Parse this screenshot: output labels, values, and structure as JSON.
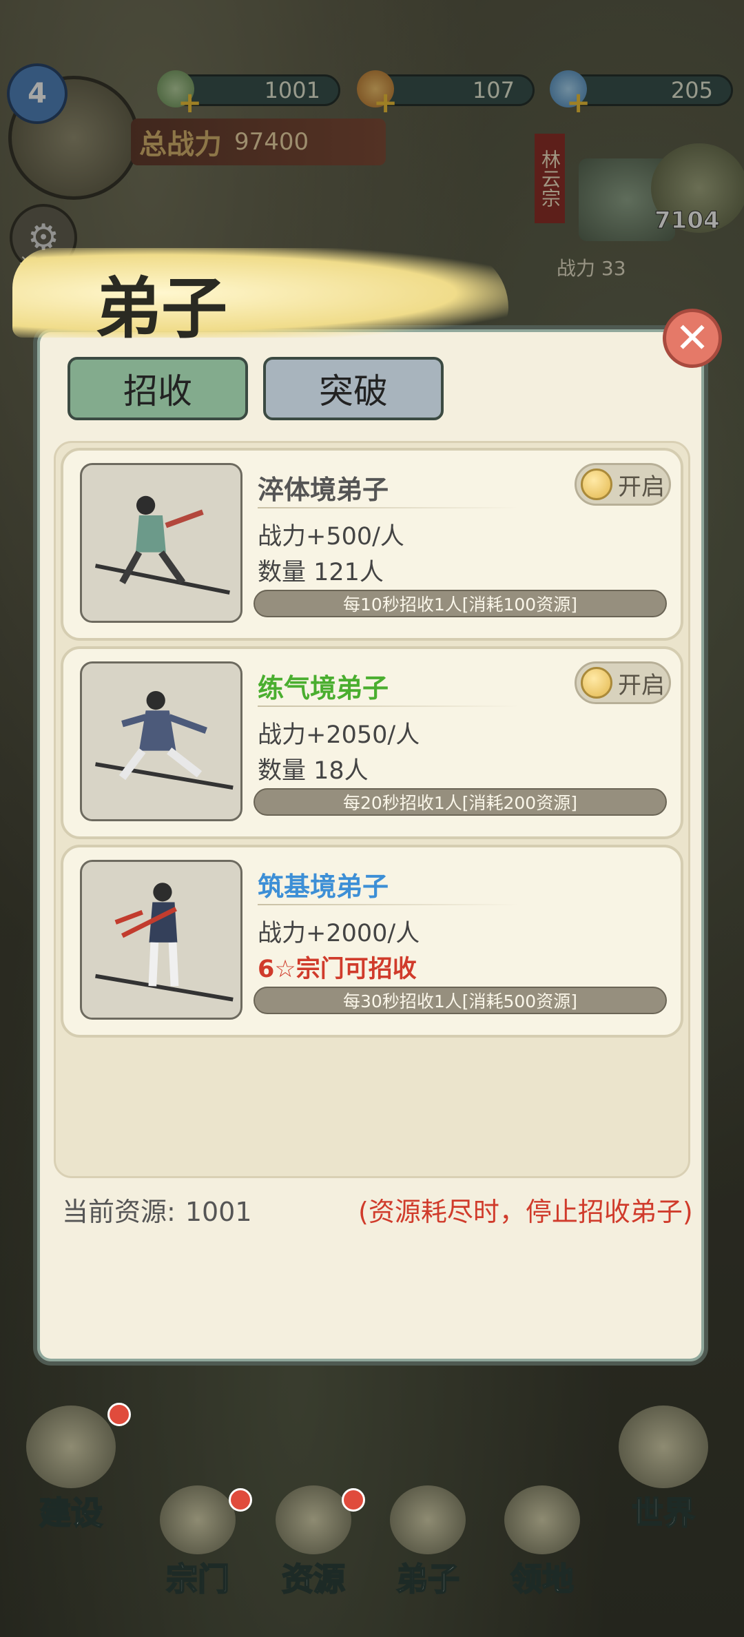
{
  "hud": {
    "level": "4",
    "resources": [
      {
        "icon": "jade-resource-icon",
        "value": "1001"
      },
      {
        "icon": "gourd-resource-icon",
        "value": "107"
      },
      {
        "icon": "crystal-resource-icon",
        "value": "205"
      }
    ],
    "power_label": "总战力",
    "power_value": "97400",
    "settings_label": "设置",
    "sect_name": "林云宗",
    "bag_count": "7104",
    "side_label": "战力 33"
  },
  "modal": {
    "title": "弟子",
    "tabs": [
      {
        "label": "招收",
        "active": true
      },
      {
        "label": "突破",
        "active": false
      }
    ],
    "disciples": [
      {
        "name": "淬体境弟子",
        "name_color": "#555555",
        "power": "战力+500/人",
        "extra": "数量 121人",
        "extra_warning": false,
        "toggle": "开启",
        "rate": "每10秒招收1人[消耗100资源]"
      },
      {
        "name": "练气境弟子",
        "name_color": "#4aae2f",
        "power": "战力+2050/人",
        "extra": "数量 18人",
        "extra_warning": false,
        "toggle": "开启",
        "rate": "每20秒招收1人[消耗200资源]"
      },
      {
        "name": "筑基境弟子",
        "name_color": "#3d8fd6",
        "power": "战力+2000/人",
        "extra": "6☆宗门可招收",
        "extra_warning": true,
        "toggle": null,
        "rate": "每30秒招收1人[消耗500资源]"
      }
    ],
    "footer": {
      "current_label": "当前资源:",
      "current_value": "1001",
      "warning": "(资源耗尽时，停止招收弟子)"
    }
  },
  "nav": [
    {
      "label": "建设",
      "icon": "build-icon",
      "badge": true
    },
    {
      "label": "宗门",
      "icon": "sect-icon",
      "badge": true
    },
    {
      "label": "资源",
      "icon": "resource-icon",
      "badge": true
    },
    {
      "label": "弟子",
      "icon": "disciple-icon",
      "badge": false
    },
    {
      "label": "领地",
      "icon": "territory-icon",
      "badge": false
    },
    {
      "label": "世界",
      "icon": "world-icon",
      "badge": false
    }
  ]
}
